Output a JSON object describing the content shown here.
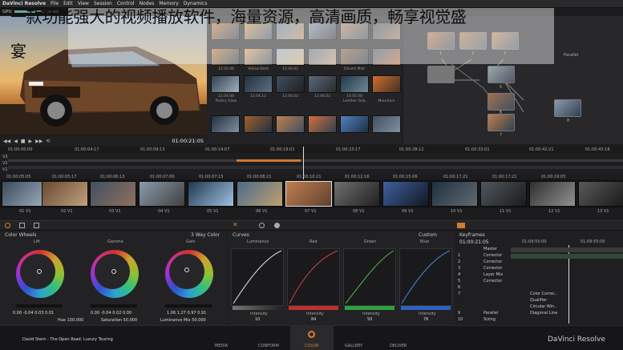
{
  "overlay_caption": {
    "line1": "一款功能强大的视频播放软件，海量资源，高清画质，畅享视觉盛",
    "line2": "宴"
  },
  "menu": {
    "app": "DaVinci Resolve",
    "items": [
      "File",
      "Edit",
      "View",
      "Session",
      "Control",
      "Nodes",
      "Memory",
      "Dynamics"
    ]
  },
  "gpu_label": "GPU",
  "viewer": {
    "timecode": "01:00:21:05"
  },
  "gallery_labels": [
    "12.02.06",
    "12.02.06",
    "12.02.05",
    "Yellow Dark",
    "12.02.06",
    "Yellow Dark",
    "12.04.02",
    "Desert Mist",
    "12.04.08",
    "12.04.12",
    "12.04.02",
    "12.04.02",
    "10.05.08",
    "Pastry Glow",
    "Yellow Dark",
    "Leather Grip",
    "Mountain"
  ],
  "nodes": {
    "parallel": "Parallel",
    "labels": [
      "1",
      "2",
      "3",
      "4",
      "5",
      "6",
      "7",
      "8"
    ]
  },
  "ruler": [
    "01:00:00:00",
    "01:00:04:17",
    "01:00:09:13",
    "01:00:14:07",
    "01:00:19:01",
    "01:00:23:17",
    "01:00:28:12",
    "01:00:33:01",
    "01:00:42:21",
    "01:00:43:18"
  ],
  "tracks": [
    "V3",
    "V2",
    "V1"
  ],
  "clip_timecodes": [
    "01:00:05:05",
    "01:00:05:17",
    "01:00:06:13",
    "01:00:07:00",
    "01:00:07:15",
    "01:00:08:21",
    "01:00:10:21",
    "01:00:12:16",
    "01:00:15:06",
    "01:00:17:21",
    "01:00:17:21",
    "01:00:19:05"
  ],
  "clip_tracks": [
    "01 V1",
    "02 V1",
    "03 V1",
    "04 V1",
    "05 V1",
    "06 V1",
    "07 V1",
    "08 V1",
    "09 V1",
    "10 V1",
    "11 V1",
    "12 V1",
    "13 V1"
  ],
  "wheels": {
    "title": "Color Wheels",
    "mode": "3 Way Color",
    "lift": "Lift",
    "gamma": "Gamma",
    "gain": "Gain",
    "lift_vals": "0.00 -0.04 0.03 0.01",
    "gamma_vals": "0.00 -0.04 0.02 0.00",
    "gain_vals": "1.06 1.27 0.97 0.91",
    "hue": "Hue 100.000",
    "sat": "Saturation 50.000",
    "lum": "Luminance Mix 50.000"
  },
  "curves": {
    "title": "Curves",
    "mode": "Custom",
    "labels": [
      "Luminance",
      "Red",
      "Green",
      "Blue"
    ],
    "intensity": "Intensity",
    "vals": [
      "10",
      "84",
      "50",
      "76"
    ]
  },
  "keyframes": {
    "title": "Keyframes",
    "tc": "01:00:21:05",
    "tc2": "01:09:55:00",
    "tc3": "01:09:55:00",
    "rows": [
      "Master",
      "Corrector",
      "Corrector",
      "Corrector",
      "Layer Mix",
      "Corrector",
      "",
      "",
      "Color Correc..",
      "Qualifier",
      "Circular Win..",
      "Diagonal Line",
      "Parallel",
      "Sizing"
    ],
    "nums": [
      "1",
      "2",
      "3",
      "4",
      "5",
      "6",
      "7",
      "8",
      "9",
      "10"
    ]
  },
  "footer": {
    "user": "David Stern - The Open Road: Luxury Touring",
    "tabs": [
      "MEDIA",
      "CONFORM",
      "COLOR",
      "GALLERY",
      "DELIVER"
    ],
    "brand": "DaVinci Resolve"
  }
}
